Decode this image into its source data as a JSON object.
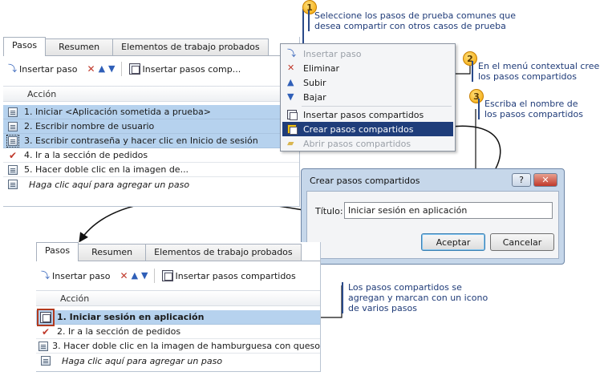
{
  "callouts": {
    "c1": {
      "num": "1",
      "line1": "Seleccione los pasos de prueba comunes que",
      "line2": "desea compartir con otros casos de prueba"
    },
    "c2": {
      "num": "2",
      "line1": "En el menú contextual cree",
      "line2": "los pasos compartidos"
    },
    "c3": {
      "num": "3",
      "line1": "Escriba el nombre de",
      "line2": "los pasos compartidos"
    },
    "c4": {
      "line1": "Los pasos compartidos se",
      "line2": "agregan y marcan con un icono",
      "line3": "de varios pasos"
    }
  },
  "top_panel": {
    "tabs": [
      "Pasos",
      "Resumen",
      "Elementos de trabajo probados"
    ],
    "toolbar": {
      "insert_step": "Insertar paso",
      "insert_shared": "Insertar pasos comp..."
    },
    "column": "Acción",
    "rows": [
      {
        "text": "1. Iniciar <Aplicación sometida a prueba>",
        "selected": true
      },
      {
        "text": "2. Escribir nombre de usuario",
        "selected": true
      },
      {
        "text": "3. Escribir contraseña y hacer clic en Inicio de sesión",
        "selected": true
      },
      {
        "text": "4. Ir a la sección de pedidos",
        "selected": false
      },
      {
        "text": "5. Hacer doble clic en la imagen de...",
        "selected": false
      },
      {
        "text": "Haga clic aquí para agregar un paso",
        "selected": false
      }
    ]
  },
  "menu": {
    "items": [
      "Insertar paso",
      "Eliminar",
      "Subir",
      "Bajar",
      "Insertar pasos compartidos",
      "Crear pasos compartidos",
      "Abrir pasos compartidos"
    ]
  },
  "dialog": {
    "title": "Crear pasos compartidos",
    "help": "?",
    "close": "✕",
    "label": "Título:",
    "value": "Iniciar sesión en aplicación",
    "ok": "Aceptar",
    "cancel": "Cancelar"
  },
  "bottom_panel": {
    "tabs": [
      "Pasos",
      "Resumen",
      "Elementos de trabajo probados"
    ],
    "toolbar": {
      "insert_step": "Insertar paso",
      "insert_shared": "Insertar pasos compartidos"
    },
    "column": "Acción",
    "rows": [
      {
        "text": "1. Iniciar sesión en aplicación",
        "selected": true
      },
      {
        "text": "2. Ir a la sección de pedidos",
        "selected": false
      },
      {
        "text": "3. Hacer doble clic en la imagen de hamburguesa con queso",
        "selected": false
      },
      {
        "text": "Haga clic aquí para agregar un paso",
        "selected": false
      }
    ]
  },
  "colors": {
    "accent": "#1f3d7a",
    "selection": "#b6d2ee",
    "callout_text": "#1f3b78",
    "badge": "#f2a200"
  }
}
